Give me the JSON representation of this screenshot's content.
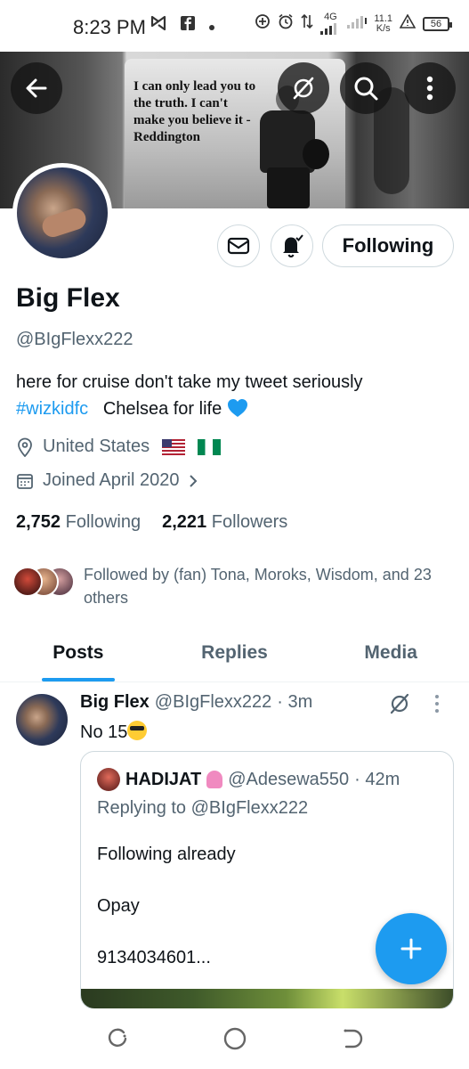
{
  "status_bar": {
    "time": "8:23 PM",
    "network": "4G",
    "speed_value": "11.1",
    "speed_unit": "K/s",
    "battery": "56"
  },
  "banner": {
    "quote": "I can only lead you to the truth. I can't make you believe it - Reddington"
  },
  "profile": {
    "follow_button": "Following",
    "display_name": "Big Flex",
    "handle": "@BIgFlexx222",
    "bio_text": "here for cruise don't take my tweet seriously",
    "bio_hashtag": "#wizkidfc",
    "bio_tail": "Chelsea for life",
    "location": "United States",
    "joined": "Joined April 2020",
    "following_count": "2,752",
    "following_label": "Following",
    "followers_count": "2,221",
    "followers_label": "Followers",
    "followed_by": "Followed by (fan) Tona, Moroks, Wisdom, and 23 others"
  },
  "tabs": [
    {
      "label": "Posts"
    },
    {
      "label": "Replies"
    },
    {
      "label": "Media"
    }
  ],
  "tweet": {
    "name": "Big Flex",
    "handle": "@BIgFlexx222",
    "time": "· 3m",
    "text": "No 15",
    "quote": {
      "name": "HADIJAT",
      "handle": "@Adesewa550",
      "time": "· 42m",
      "replying_to": "Replying to @BIgFlexx222",
      "line1": "Following already",
      "line2": "Opay",
      "line3": "9134034601..."
    }
  },
  "colors": {
    "accent": "#1d9bf0",
    "text_primary": "#0f1419",
    "text_secondary": "#536471"
  }
}
